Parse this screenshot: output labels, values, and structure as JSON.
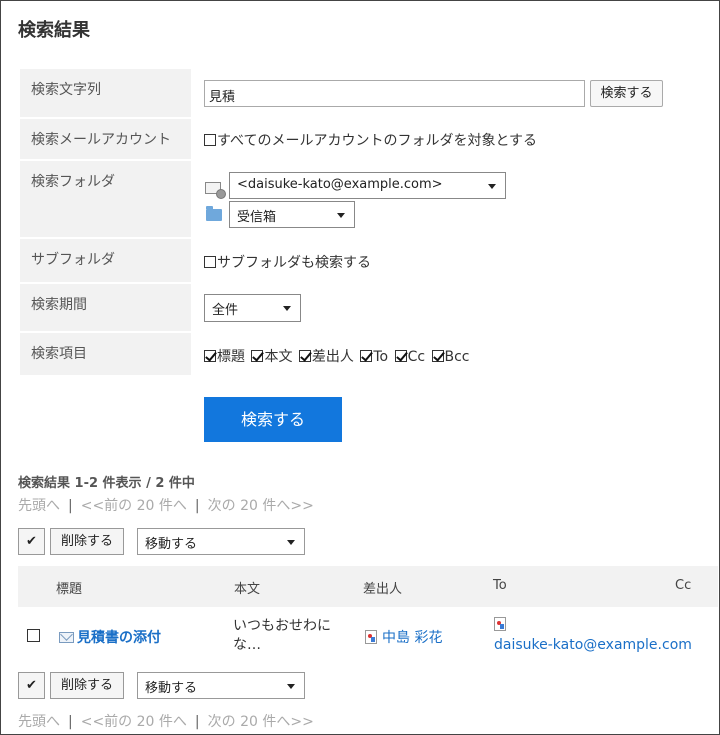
{
  "page_title": "検索結果",
  "form": {
    "keyword_label": "検索文字列",
    "keyword_value": "見積",
    "search_small_label": "検索する",
    "account_label": "検索メールアカウント",
    "all_accounts_text": "すべてのメールアカウントのフォルダを対象とする",
    "folder_label": "検索フォルダ",
    "account_select": "<daisuke-kato@example.com>",
    "folder_select": "受信箱",
    "subfolder_label": "サブフォルダ",
    "subfolder_text": "サブフォルダも検索する",
    "period_label": "検索期間",
    "period_select": "全件",
    "items_label": "検索項目",
    "items": [
      {
        "label": "標題",
        "checked": true
      },
      {
        "label": "本文",
        "checked": true
      },
      {
        "label": "差出人",
        "checked": true
      },
      {
        "label": "To",
        "checked": true
      },
      {
        "label": "Cc",
        "checked": true
      },
      {
        "label": "Bcc",
        "checked": true
      }
    ],
    "submit_label": "検索する"
  },
  "results": {
    "summary": "検索結果 1-2 件表示 / 2 件中",
    "pager": {
      "first": "先頭へ",
      "prev": "<<前の 20 件へ",
      "next": "次の 20 件へ>>",
      "separator": "|"
    },
    "toolbar": {
      "check_all_glyph": "✔",
      "delete_label": "削除する",
      "move_select": "移動する"
    },
    "columns": [
      "標題",
      "本文",
      "差出人",
      "To",
      "Cc"
    ],
    "rows": [
      {
        "subject": "見積書の添付",
        "body_line1": "いつもおせわに",
        "body_line2": "な…",
        "sender": "中島 彩花",
        "to": "daisuke-kato@example.com",
        "cc": ""
      }
    ]
  },
  "colors": {
    "primary": "#1277dd",
    "link": "#1a6fc7",
    "label_bg": "#f2f2f2",
    "disabled_text": "#aaaaaa"
  }
}
